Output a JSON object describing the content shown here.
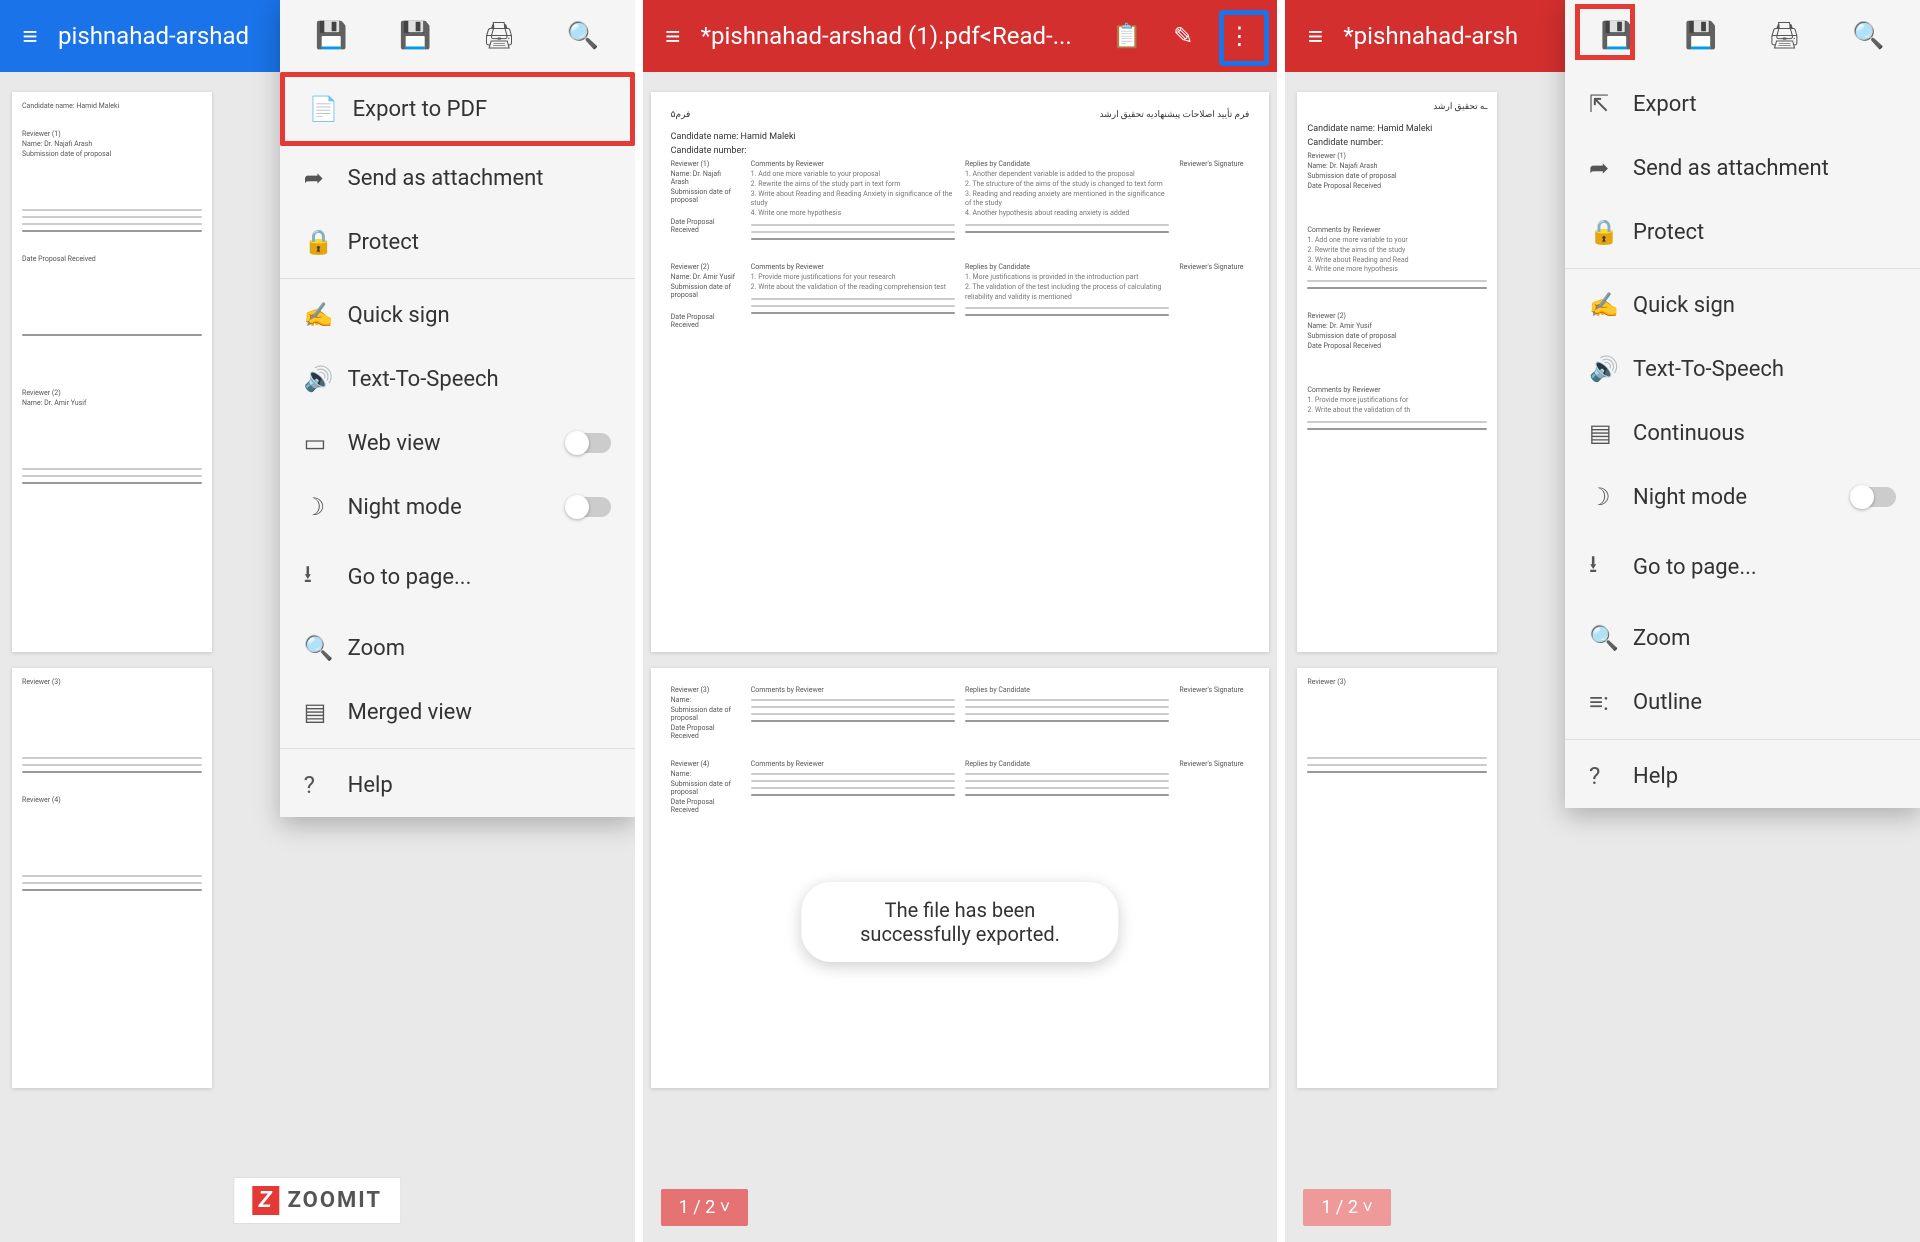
{
  "screen1": {
    "title": "pishnahad-arshad",
    "menu": [
      {
        "icon": "📄",
        "label": "Export to PDF",
        "highlight": true
      },
      {
        "icon": "➦",
        "label": "Send as attachment"
      },
      {
        "icon": "🔒",
        "label": "Protect"
      },
      {
        "sep": true
      },
      {
        "icon": "✍",
        "label": "Quick sign"
      },
      {
        "icon": "🔊",
        "label": "Text-To-Speech"
      },
      {
        "icon": "▭",
        "label": "Web view",
        "toggle": true
      },
      {
        "icon": "☽",
        "label": "Night mode",
        "toggle": true
      },
      {
        "icon": "⭳",
        "label": "Go to page..."
      },
      {
        "icon": "🔍",
        "label": "Zoom"
      },
      {
        "icon": "▤",
        "label": "Merged view"
      },
      {
        "sep": true
      },
      {
        "icon": "?",
        "label": "Help"
      }
    ],
    "iconrow": [
      "save",
      "save-as",
      "print",
      "find"
    ]
  },
  "screen2": {
    "title": "*pishnahad-arshad (1).pdf<Read-...",
    "toolbar_icons": [
      "clipboard",
      "edit",
      "more"
    ],
    "toast": "The file has been successfully exported.",
    "page_indicator": "1 / 2 ˅",
    "doc": {
      "header_right": "فرم تأیید اصلاحات پیشنهادیه تحقیق ارشد",
      "header_left": "فرم۵",
      "candidate_name_label": "Candidate name: Hamid Maleki",
      "candidate_number_label": "Candidate number:",
      "labels": {
        "reviewer1": "Reviewer (1)",
        "name1": "Name: Dr. Najafi Arash",
        "reviewer2": "Reviewer (2)",
        "name2": "Name: Dr. Amir Yusif",
        "reviewer3": "Reviewer (3)",
        "reviewer4": "Reviewer (4)",
        "submission": "Submission date of proposal",
        "date_received": "Date Proposal Received",
        "comments": "Comments by Reviewer",
        "replies": "Replies by Candidate",
        "sig": "Reviewer's Signature",
        "name": "Name:"
      }
    }
  },
  "screen3": {
    "title": "*pishnahad-arsh",
    "menu": [
      {
        "icon": "⇱",
        "label": "Export"
      },
      {
        "icon": "➦",
        "label": "Send as attachment"
      },
      {
        "icon": "🔒",
        "label": "Protect"
      },
      {
        "sep": true
      },
      {
        "icon": "✍",
        "label": "Quick sign"
      },
      {
        "icon": "🔊",
        "label": "Text-To-Speech"
      },
      {
        "icon": "▤",
        "label": "Continuous"
      },
      {
        "icon": "☽",
        "label": "Night mode",
        "toggle": true
      },
      {
        "icon": "⭳",
        "label": "Go to page..."
      },
      {
        "icon": "🔍",
        "label": "Zoom"
      },
      {
        "icon": "≡:",
        "label": "Outline"
      },
      {
        "sep": true
      },
      {
        "icon": "?",
        "label": "Help"
      }
    ],
    "iconrow": [
      "save",
      "save-as",
      "print",
      "find"
    ],
    "page_indicator": "1 / 2 ˅"
  },
  "watermark": "ZOOMIT",
  "icons": {
    "save": "💾",
    "save-as": "💾",
    "print": "🖨",
    "find": "🔍",
    "clipboard": "📋",
    "edit": "✎",
    "more": "⋮",
    "hamburger": "≡"
  }
}
